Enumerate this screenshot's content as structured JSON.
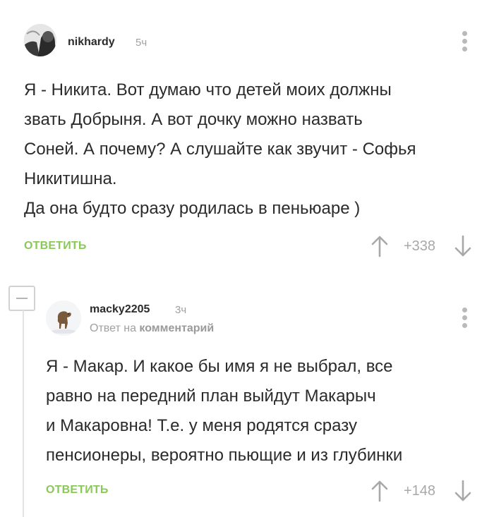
{
  "comments": [
    {
      "author": "nikhardy",
      "time": "5ч",
      "text": "Я - Никита. Вот думаю что детей моих должны\nзвать Добрыня. А вот дочку можно назвать\nСоней. А почему? А слушайте как звучит - Софья\nНикитишна.\nДа она будто сразу родилась в пеньюаре )",
      "reply_label": "ОТВЕТИТЬ",
      "score": "+338",
      "avatar_icon": "user-photo-avatar"
    },
    {
      "author": "macky2205",
      "time": "3ч",
      "reply_to_prefix": "Ответ на",
      "reply_to_target": "комментарий",
      "text": "Я - Макар. И какое бы имя я не выбрал, все\nравно на передний план выйдут Макарыч\nи Макаровна! Т.е. у меня родятся сразу\nпенсионеры, вероятно пьющие и из глубинки",
      "reply_label": "ОТВЕТИТЬ",
      "score": "+148",
      "avatar_icon": "dog-avatar"
    }
  ],
  "colors": {
    "accent_green": "#8ac858",
    "muted_gray": "#a0a0a0",
    "text_dark": "#2b2b2b"
  }
}
